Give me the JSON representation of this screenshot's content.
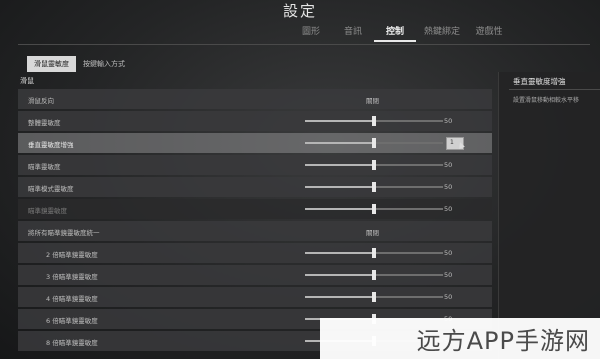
{
  "header": {
    "title": "設定",
    "tabs": [
      {
        "label": "圖形",
        "active": false
      },
      {
        "label": "音訊",
        "active": false
      },
      {
        "label": "控制",
        "active": true
      },
      {
        "label": "熱鍵綁定",
        "active": false
      },
      {
        "label": "遊戲性",
        "active": false
      }
    ]
  },
  "sub_tabs": [
    {
      "label": "滑鼠靈敏度",
      "active": true
    },
    {
      "label": "按鍵輸入方式",
      "active": false
    }
  ],
  "section": {
    "title": "滑鼠"
  },
  "rows": [
    {
      "label": "滑鼠反向",
      "type": "toggle",
      "value": "關閉"
    },
    {
      "label": "整體靈敏度",
      "type": "slider",
      "value": "50",
      "level": 0.5
    },
    {
      "label": "垂直靈敏度增強",
      "type": "slider-input",
      "value": "1",
      "level": 0.5,
      "highlight": true
    },
    {
      "label": "瞄準靈敏度",
      "type": "slider",
      "value": "50",
      "level": 0.5
    },
    {
      "label": "瞄準模式靈敏度",
      "type": "slider",
      "value": "50",
      "level": 0.5
    },
    {
      "label": "瞄準鏡靈敏度",
      "type": "slider",
      "value": "50",
      "level": 0.5,
      "dim": true
    },
    {
      "label": "將所有瞄準鏡靈敏度統一",
      "type": "toggle",
      "value": "關閉"
    },
    {
      "label": "2 倍瞄準鏡靈敏度",
      "type": "slider",
      "value": "50",
      "level": 0.5,
      "sub": true
    },
    {
      "label": "3 倍瞄準鏡靈敏度",
      "type": "slider",
      "value": "50",
      "level": 0.5,
      "sub": true
    },
    {
      "label": "4 倍瞄準鏡靈敏度",
      "type": "slider",
      "value": "50",
      "level": 0.5,
      "sub": true
    },
    {
      "label": "6 倍瞄準鏡靈敏度",
      "type": "slider",
      "value": "50",
      "level": 0.5,
      "sub": true
    },
    {
      "label": "8 倍瞄準鏡靈敏度",
      "type": "slider",
      "value": "50",
      "level": 0.5,
      "sub": true
    }
  ],
  "detail": {
    "title": "垂直靈敏度增強",
    "description": "設置滑鼠移動相較水平移"
  },
  "watermark": "远方APP手游网"
}
